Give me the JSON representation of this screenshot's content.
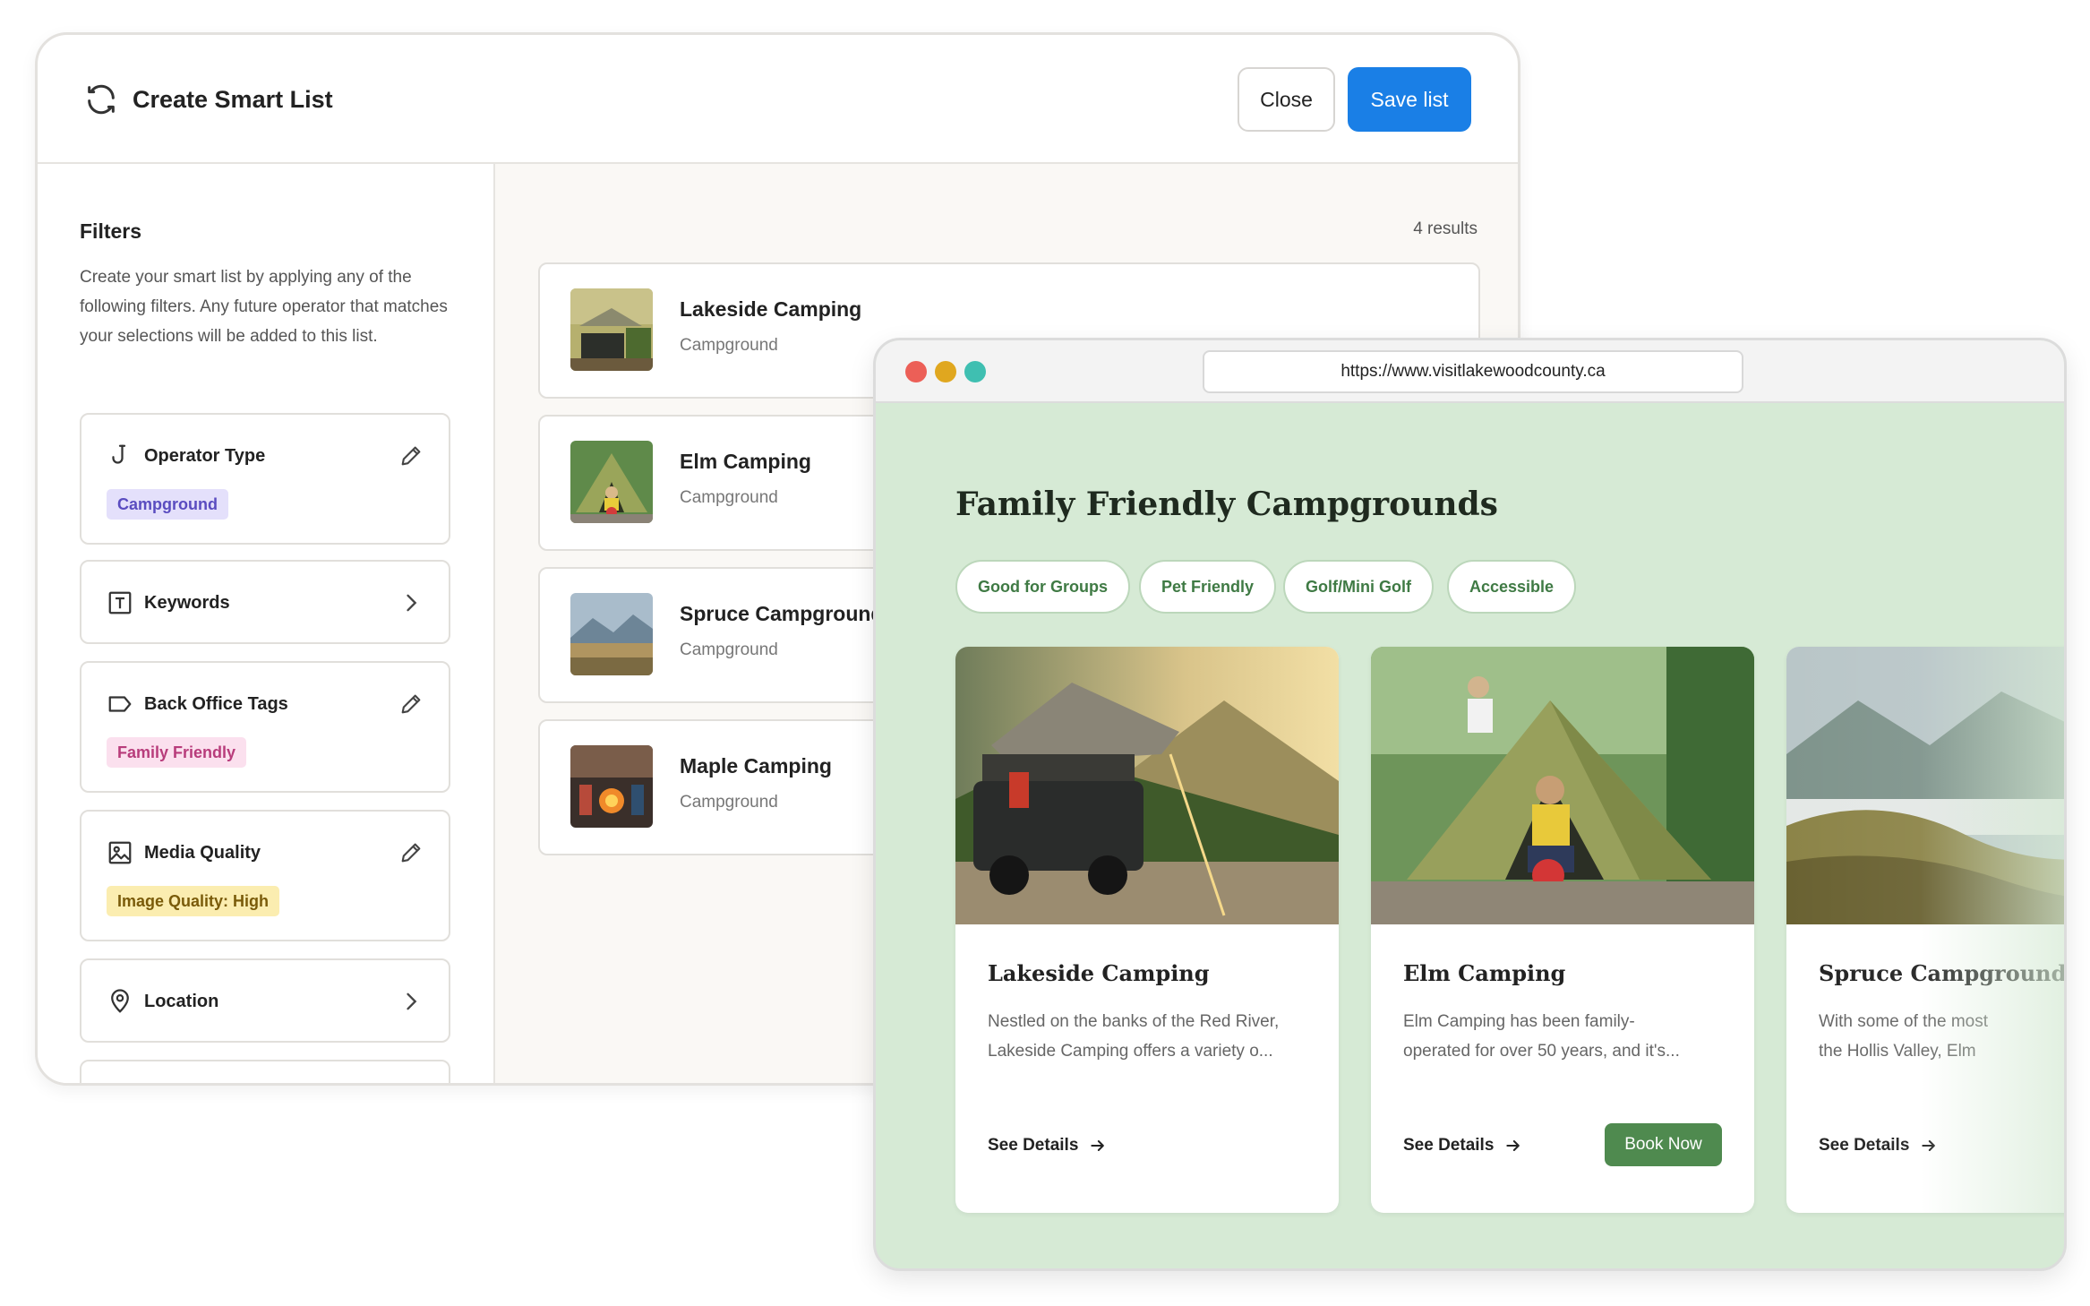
{
  "admin": {
    "title": "Create Smart List",
    "close_label": "Close",
    "save_label": "Save list",
    "filters_title": "Filters",
    "filters_description": "Create your smart list by applying any of the following filters. Any future operator that matches your selections will be added to this list.",
    "filters": [
      {
        "label": "Operator Type",
        "icon": "hook-icon",
        "action": "edit",
        "tag": "Campground",
        "tag_color": "#e4e0fb"
      },
      {
        "label": "Keywords",
        "icon": "text-box-icon",
        "action": "chevron"
      },
      {
        "label": "Back Office Tags",
        "icon": "tag-icon",
        "action": "edit",
        "tag": "Family Friendly",
        "tag_color": "#fbe0ee"
      },
      {
        "label": "Media Quality",
        "icon": "image-icon",
        "action": "edit",
        "tag": "Image Quality: High",
        "tag_color": "#fbedb0"
      },
      {
        "label": "Location",
        "icon": "map-pin-icon",
        "action": "chevron"
      }
    ],
    "results_count": "4 results",
    "results": [
      {
        "name": "Lakeside Camping",
        "type": "Campground"
      },
      {
        "name": "Elm Camping",
        "type": "Campground"
      },
      {
        "name": "Spruce Campground",
        "type": "Campground"
      },
      {
        "name": "Maple Camping",
        "type": "Campground"
      }
    ],
    "accent_color": "#1a7fe6"
  },
  "browser": {
    "url": "https://www.visitlakewoodcounty.ca",
    "page_title": "Family Friendly Campgrounds",
    "chips": [
      "Good for Groups",
      "Pet Friendly",
      "Golf/Mini Golf",
      "Accessible"
    ],
    "cards": [
      {
        "title": "Lakeside Camping",
        "desc_1": "Nestled on the banks of the Red River,",
        "desc_2": "Lakeside Camping offers a variety o...",
        "link": "See Details"
      },
      {
        "title": "Elm Camping",
        "desc_1": "Elm Camping has been family-",
        "desc_2": "operated for over 50 years, and it's...",
        "link": "See Details",
        "cta": "Book Now"
      },
      {
        "title": "Spruce Campground",
        "desc_1": "With some of the most",
        "desc_2": "the Hollis Valley, Elm",
        "link": "See Details"
      }
    ],
    "bg_color": "#d6ead5",
    "button_color": "#4f8a4f"
  }
}
